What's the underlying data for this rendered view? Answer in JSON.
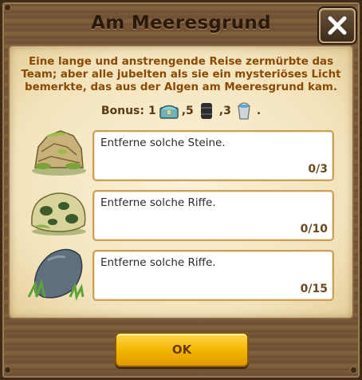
{
  "dialog": {
    "title": "Am Meeresgrund",
    "close_icon": "close-x-icon",
    "intro_text": "Eine lange und anstrengende Reise zermürbte das Team; aber alle jubelten als sie ein mysteriöses Licht bemerkte, das aus der Algen am Meeresgrund kam.",
    "bonus": {
      "label": "Bonus:",
      "items": [
        {
          "amount": "1",
          "icon": "treasure-chest-icon"
        },
        {
          "amount": ",5",
          "icon": "oil-barrel-icon"
        },
        {
          "amount": ",3",
          "icon": "water-bucket-icon"
        }
      ],
      "end": "."
    },
    "tasks": [
      {
        "text": "Entferne solche Steine.",
        "progress": "0/3",
        "icon": "mossy-rocks-icon"
      },
      {
        "text": "Entferne solche Riffe.",
        "progress": "0/10",
        "icon": "coral-reef-icon"
      },
      {
        "text": "Entferne solche Riffe.",
        "progress": "0/15",
        "icon": "grey-stone-icon"
      }
    ],
    "ok_label": "OK"
  }
}
